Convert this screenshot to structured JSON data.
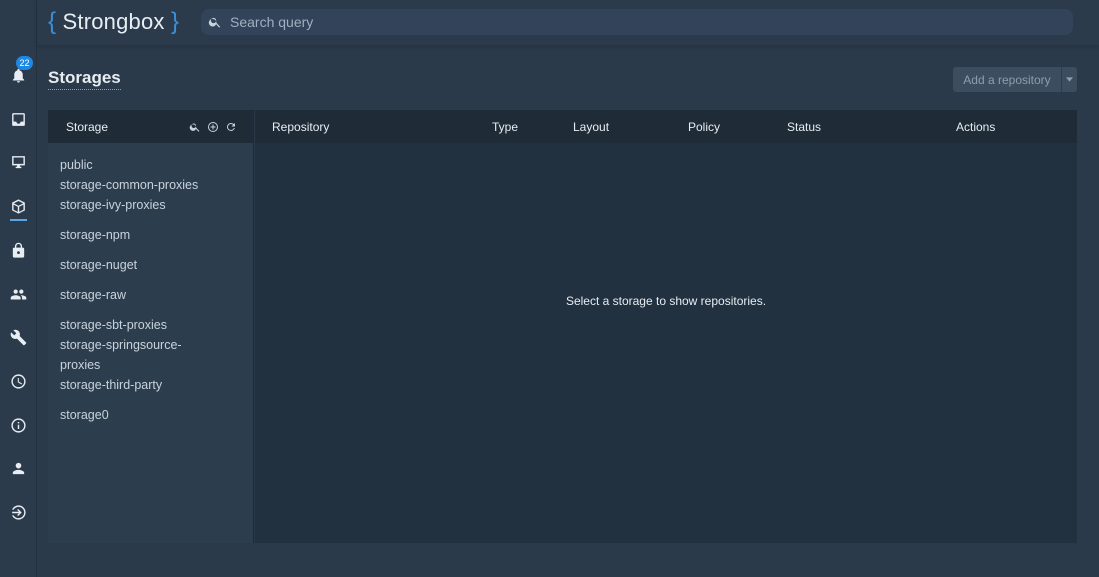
{
  "app": {
    "logo_open": "{",
    "logo_name": "Strongbox",
    "logo_close": "}"
  },
  "search": {
    "placeholder": "Search query"
  },
  "rail": {
    "notification_count": "22",
    "items": [
      {
        "icon": "bell-icon"
      },
      {
        "icon": "inbox-icon"
      },
      {
        "icon": "monitor-icon"
      },
      {
        "icon": "cube-icon",
        "active": true
      },
      {
        "icon": "lock-icon"
      },
      {
        "icon": "users-icon"
      },
      {
        "icon": "wrench-icon"
      },
      {
        "icon": "clock-icon"
      },
      {
        "icon": "info-icon"
      },
      {
        "icon": "user-icon"
      },
      {
        "icon": "logout-icon"
      }
    ]
  },
  "page": {
    "title": "Storages",
    "add_repository": "Add a repository"
  },
  "storage_panel": {
    "header": "Storage",
    "storages": [
      "public",
      "storage-common-proxies",
      "storage-ivy-proxies",
      "storage-npm",
      "storage-nuget",
      "storage-raw",
      "storage-sbt-proxies",
      "storage-springsource-proxies",
      "storage-third-party",
      "storage0"
    ]
  },
  "repository_table": {
    "columns": [
      "Repository",
      "Type",
      "Layout",
      "Policy",
      "Status",
      "Actions"
    ],
    "empty_message": "Select a storage to show repositories."
  },
  "colors": {
    "accent": "#1e88e5",
    "brace": "#3d8fd6",
    "background": "#2a3a4a"
  }
}
